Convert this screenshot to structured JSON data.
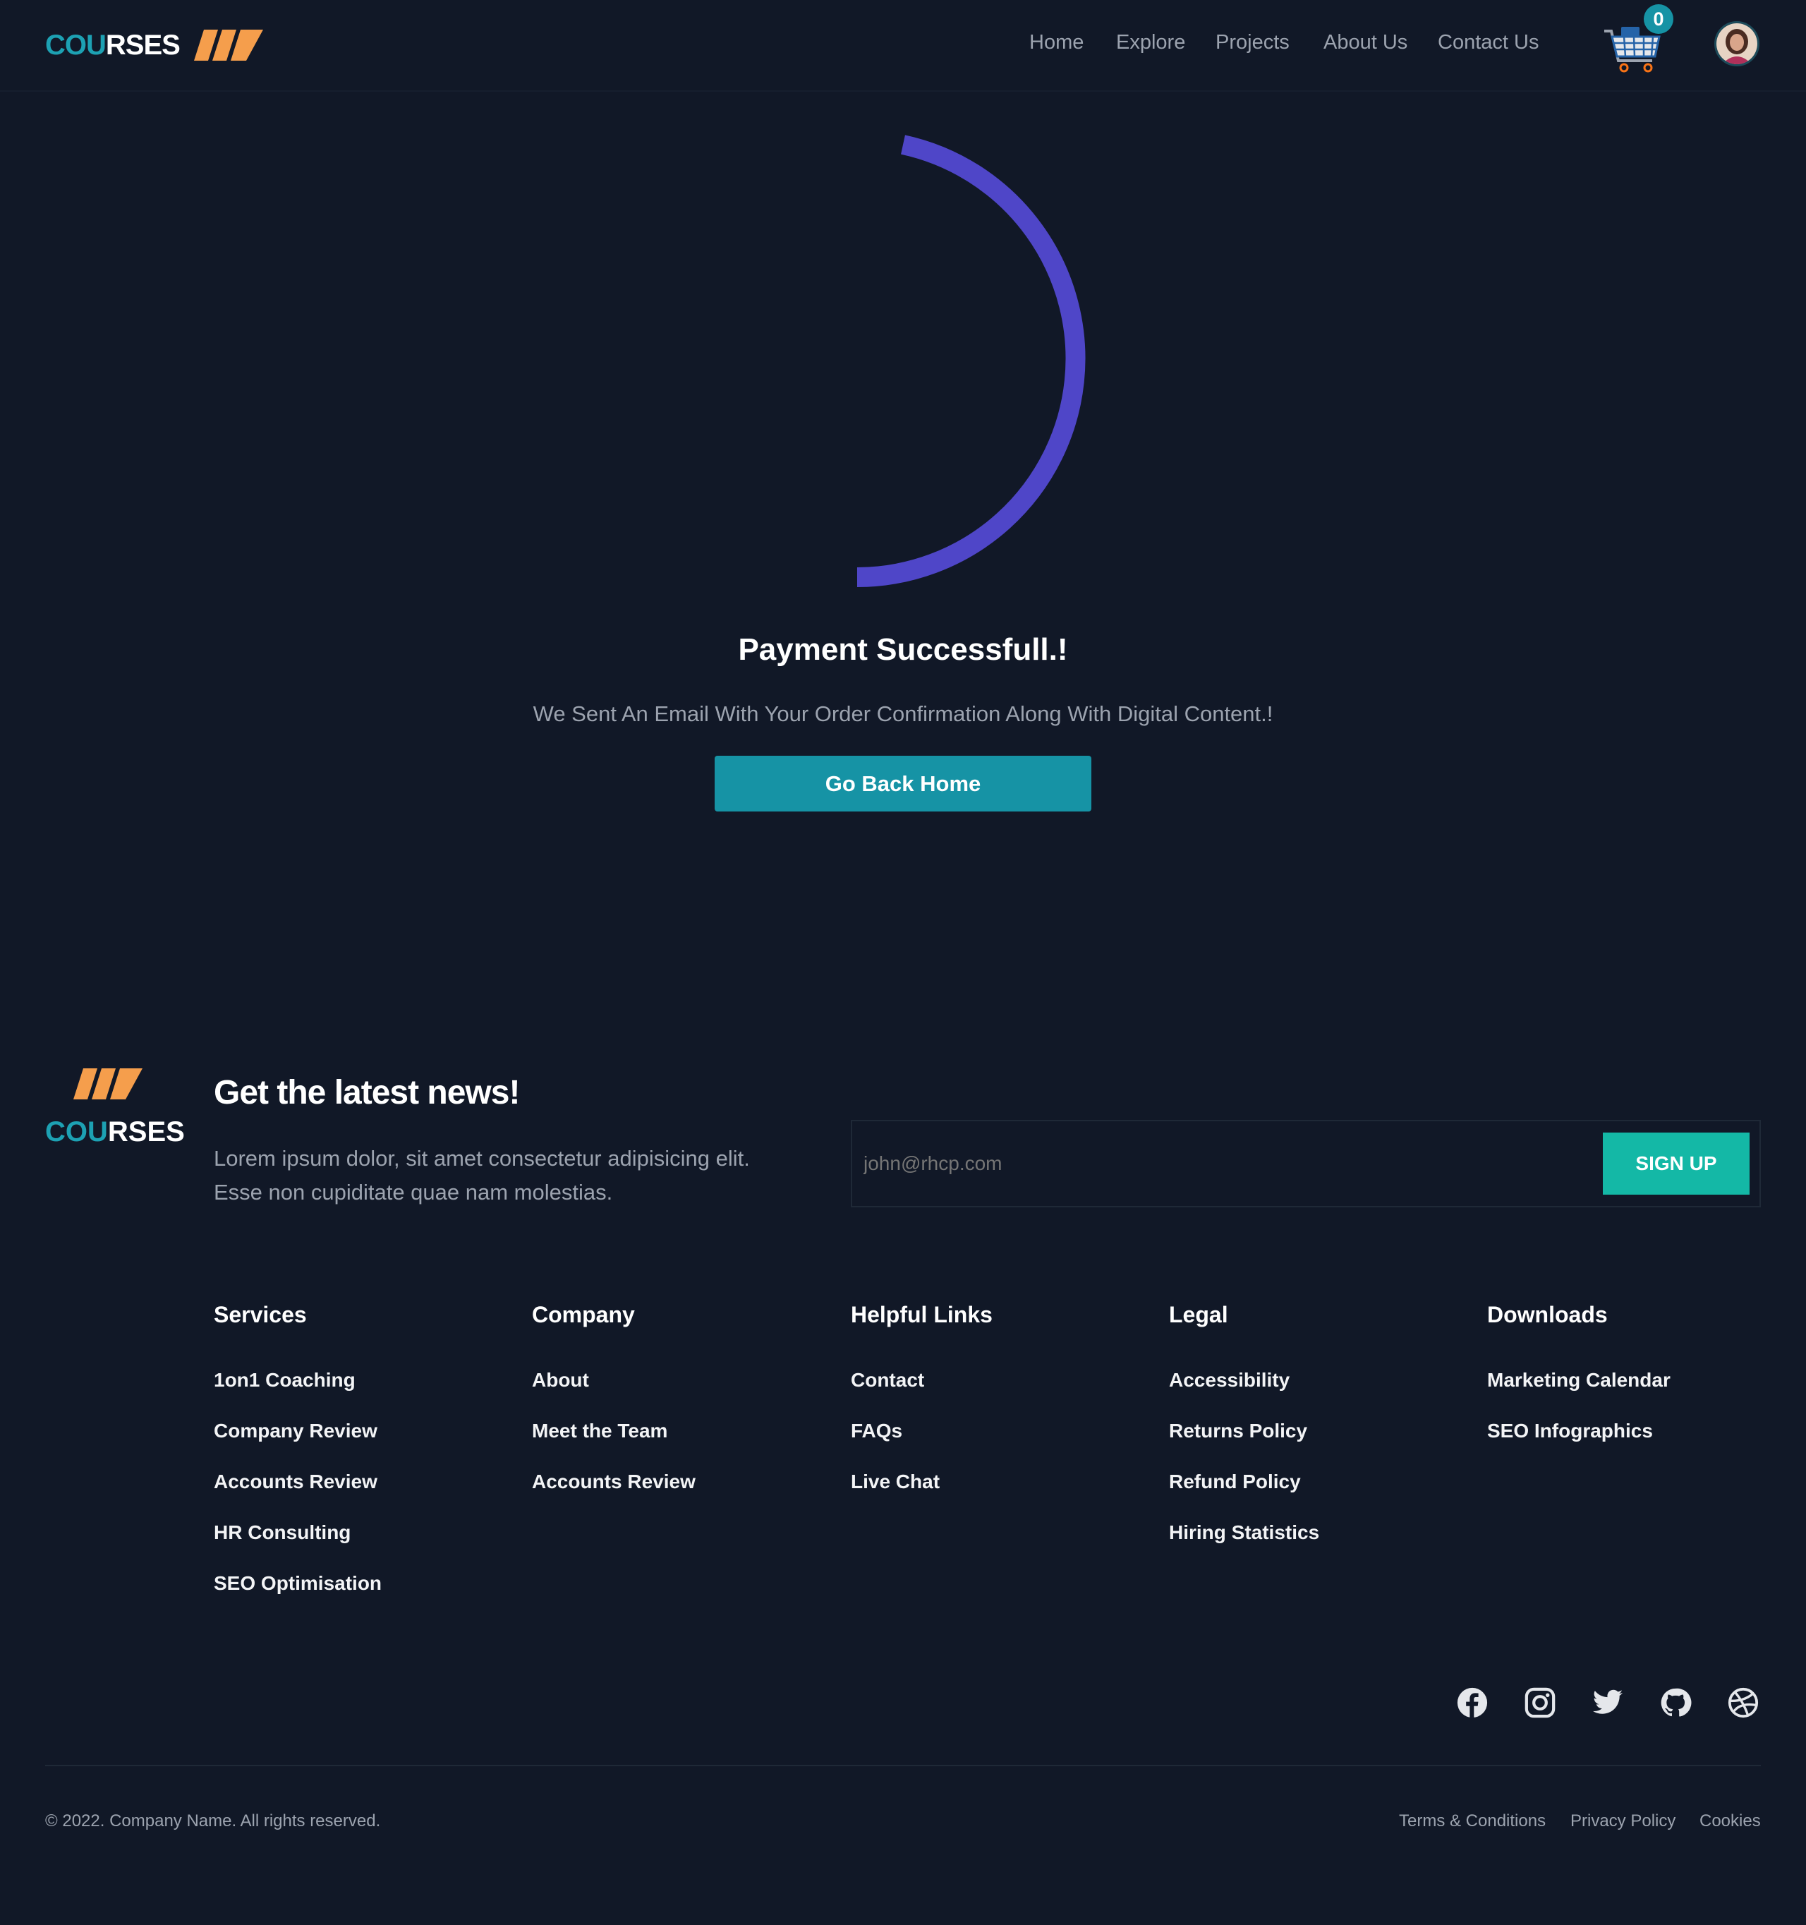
{
  "brand": {
    "part1": "COU",
    "part2": "RSES",
    "stripe_color": "#f59e4c",
    "accent": "#1da1b3"
  },
  "nav": {
    "items": [
      "Home",
      "Explore",
      "Projects",
      "About Us",
      "Contact Us"
    ]
  },
  "cart": {
    "count": "0"
  },
  "main": {
    "title": "Payment Successfull.!",
    "subtitle": "We Sent An Email With Your Order Confirmation Along With Digital Content.!",
    "button": "Go Back Home",
    "spinner_color": "#4f46c8"
  },
  "newsletter": {
    "title": "Get the latest news!",
    "text_line1": "Lorem ipsum dolor, sit amet consectetur adipisicing elit.",
    "text_line2": "Esse non cupiditate quae nam molestias.",
    "placeholder": "john@rhcp.com",
    "button": "SIGN UP"
  },
  "footer": {
    "columns": [
      {
        "heading": "Services",
        "links": [
          "1on1 Coaching",
          "Company Review",
          "Accounts Review",
          "HR Consulting",
          "SEO Optimisation"
        ]
      },
      {
        "heading": "Company",
        "links": [
          "About",
          "Meet the Team",
          "Accounts Review"
        ]
      },
      {
        "heading": "Helpful Links",
        "links": [
          "Contact",
          "FAQs",
          "Live Chat"
        ]
      },
      {
        "heading": "Legal",
        "links": [
          "Accessibility",
          "Returns Policy",
          "Refund Policy",
          "Hiring Statistics"
        ]
      },
      {
        "heading": "Downloads",
        "links": [
          "Marketing Calendar",
          "SEO Infographics"
        ]
      }
    ],
    "social": [
      "facebook-icon",
      "instagram-icon",
      "twitter-icon",
      "github-icon",
      "dribbble-icon"
    ],
    "copyright": "© 2022. Company Name. All rights reserved.",
    "legal_links": [
      "Terms & Conditions",
      "Privacy Policy",
      "Cookies"
    ]
  }
}
